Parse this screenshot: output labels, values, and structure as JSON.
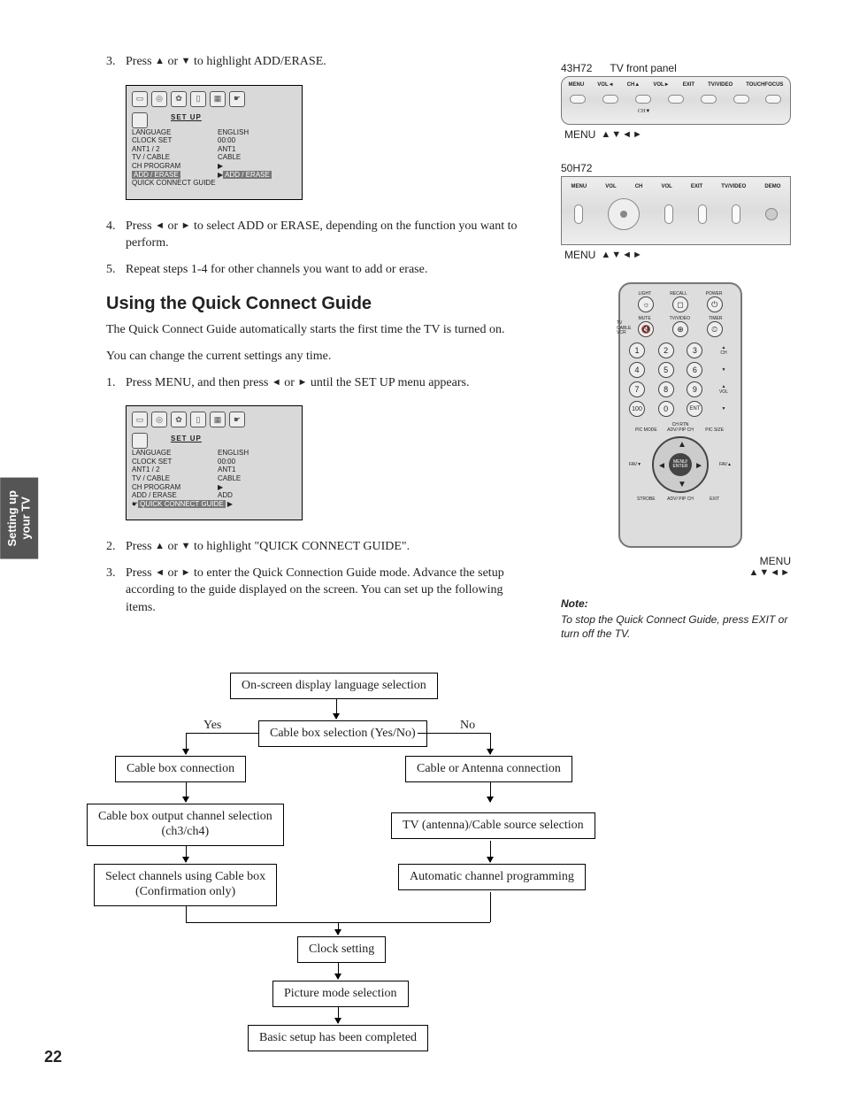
{
  "page_number": "22",
  "side_tab_line1": "Setting up",
  "side_tab_line2": "your TV",
  "steps_a": {
    "s3_num": "3.",
    "s3_text_a": "Press ",
    "s3_text_b": " or ",
    "s3_text_c": " to highlight ADD/ERASE.",
    "s4_num": "4.",
    "s4_text_a": "Press ",
    "s4_text_b": " or ",
    "s4_text_c": " to select ADD or ERASE, depending on the function you want to perform.",
    "s5_num": "5.",
    "s5_text": "Repeat steps 1-4 for other channels you want to add or erase."
  },
  "section_heading": "Using the Quick Connect Guide",
  "para1": "The Quick Connect Guide automatically starts the first time the TV is turned on.",
  "para2": "You can change the current settings any time.",
  "steps_b": {
    "s1_num": "1.",
    "s1_text_a": "Press MENU, and then press ",
    "s1_text_b": " or ",
    "s1_text_c": " until the SET UP menu appears.",
    "s2_num": "2.",
    "s2_text_a": "Press ",
    "s2_text_b": " or ",
    "s2_text_c": " to highlight \"QUICK CONNECT GUIDE\".",
    "s3_num": "3.",
    "s3_text_a": "Press ",
    "s3_text_b": " or ",
    "s3_text_c": " to enter the Quick Connection Guide mode. Advance the setup according to the guide displayed on the screen. You can set up the following items."
  },
  "menu": {
    "setup_label": "SET  UP",
    "items": [
      {
        "l": "LANGUAGE",
        "r": "ENGLISH"
      },
      {
        "l": "CLOCK  SET",
        "r": "00:00"
      },
      {
        "l": "ANT1 / 2",
        "r": "ANT1"
      },
      {
        "l": "TV / CABLE",
        "r": "CABLE"
      },
      {
        "l": "CH  PROGRAM",
        "r": ""
      },
      {
        "l": "ADD / ERASE",
        "r": "ADD"
      },
      {
        "l": "QUICK  CONNECT  GUIDE",
        "r": ""
      }
    ],
    "menu1_highlight_right": "ADD / ERASE"
  },
  "side": {
    "model1": "43H72",
    "front_panel": "TV front panel",
    "panel_buttons": [
      "MENU",
      "VOL◄",
      "CH▲",
      "VOL►",
      "EXIT",
      "TV/VIDEO",
      "TOUCHFOCUS"
    ],
    "panel_buttons_ch_low": "CH▼",
    "caption_menu": "MENU",
    "caption_arrows": "▲▼◄►",
    "model2": "50H72",
    "panel2_labels": [
      "MENU",
      "VOL",
      "CH",
      "VOL",
      "EXIT",
      "TV/VIDEO",
      "DEMO"
    ],
    "remote": {
      "row1_labels": [
        "LIGHT",
        "RECALL",
        "POWER"
      ],
      "row2_labels": [
        "MUTE",
        "TV/VIDEO",
        "TIMER"
      ],
      "switch": [
        "TV",
        "CABLE",
        "VCR"
      ],
      "keypad": [
        "1",
        "2",
        "3",
        "4",
        "5",
        "6",
        "7",
        "8",
        "9",
        "100",
        "0",
        "ENT"
      ],
      "side_labels_top": "CH",
      "side_labels_bot": "VOL",
      "chrtn": "CH RTN",
      "diag_top": [
        "PIC MODE",
        "ADV/ PIP CH",
        "PIC SIZE"
      ],
      "nav_center": "MENU/ ENTER",
      "nav_side_l": "FAV▼",
      "nav_side_r": "FAV▲",
      "diag_bot": [
        "STROBE",
        "ADV/ PIP CH",
        "EXIT"
      ]
    },
    "remote_caption_menu": "MENU",
    "remote_caption_arrows": "▲▼◄►",
    "note_title": "Note:",
    "note_text": "To stop the Quick Connect Guide, press EXIT or turn off the TV."
  },
  "flow": {
    "b1": "On-screen display language selection",
    "yes": "Yes",
    "no": "No",
    "b2": "Cable box selection (Yes/No)",
    "b3": "Cable box connection",
    "b4": "Cable or Antenna connection",
    "b5a": "Cable box output channel selection",
    "b5b": "(ch3/ch4)",
    "b6": "TV (antenna)/Cable source selection",
    "b7a": "Select channels using Cable box",
    "b7b": "(Confirmation only)",
    "b8": "Automatic channel programming",
    "b9": "Clock setting",
    "b10": "Picture mode selection",
    "b11": "Basic setup has been completed"
  }
}
